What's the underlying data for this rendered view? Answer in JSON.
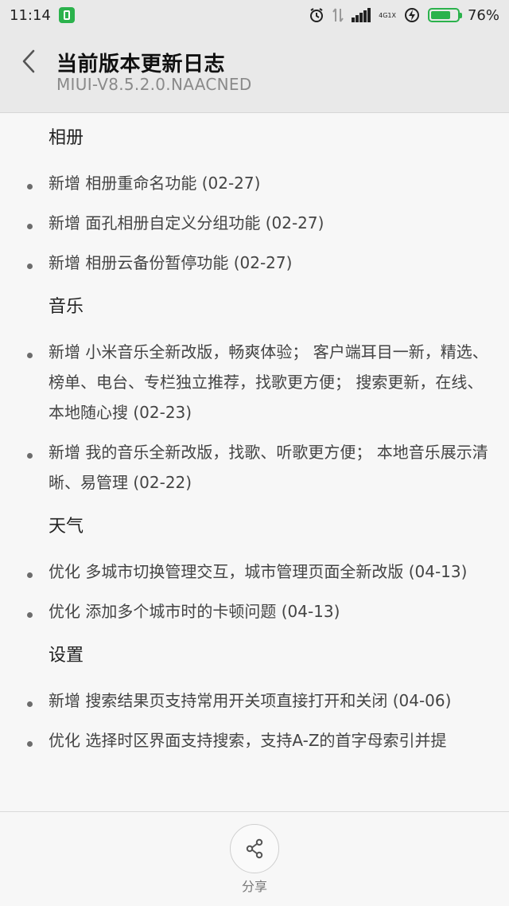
{
  "status_bar": {
    "time": "11:14",
    "battery_percent": "76%",
    "battery_level": 0.76,
    "network": "4G",
    "sim": "1X",
    "accent_color": "#2bb24c"
  },
  "header": {
    "title": "当前版本更新日志",
    "subtitle": "MIUI-V8.5.2.0.NAACNED"
  },
  "sections": [
    {
      "title": "相册",
      "items": [
        "新增 相册重命名功能 (02-27)",
        "新增 面孔相册自定义分组功能 (02-27)",
        "新增 相册云备份暂停功能 (02-27)"
      ]
    },
    {
      "title": "音乐",
      "items": [
        "新增 小米音乐全新改版，畅爽体验； 客户端耳目一新，精选、榜单、电台、专栏独立推荐，找歌更方便； 搜索更新，在线、本地随心搜 (02-23)",
        "新增 我的音乐全新改版，找歌、听歌更方便； 本地音乐展示清晰、易管理 (02-22)"
      ]
    },
    {
      "title": "天气",
      "items": [
        "优化 多城市切换管理交互，城市管理页面全新改版 (04-13)",
        "优化 添加多个城市时的卡顿问题 (04-13)"
      ]
    },
    {
      "title": "设置",
      "items": [
        "新增 搜索结果页支持常用开关项直接打开和关闭 (04-06)",
        "优化 选择时区界面支持搜索，支持A-Z的首字母索引并提"
      ]
    }
  ],
  "bottom_bar": {
    "share_label": "分享",
    "share_icon": "share-icon"
  }
}
